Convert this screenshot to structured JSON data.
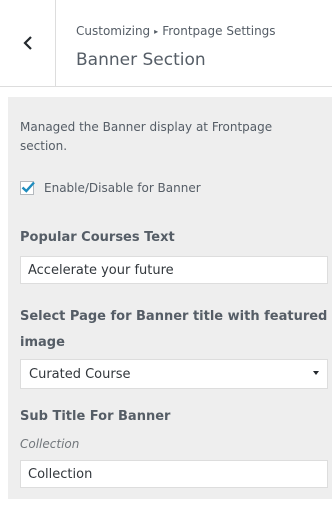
{
  "header": {
    "breadcrumb_root": "Customizing",
    "breadcrumb_separator": "▸",
    "breadcrumb_parent": "Frontpage Settings",
    "section_title": "Banner Section"
  },
  "description": "Managed the Banner display at Frontpage section.",
  "enable_banner": {
    "label": "Enable/Disable for Banner",
    "checked": true
  },
  "popular_courses": {
    "label": "Popular Courses Text",
    "value": "Accelerate your future"
  },
  "banner_page": {
    "label": "Select Page for Banner title with featured image",
    "selected": "Curated Course"
  },
  "sub_title": {
    "label": "Sub Title For Banner",
    "description": "Collection",
    "value": "Collection"
  },
  "colors": {
    "accent": "#0073aa",
    "text": "#555d66",
    "panel_bg": "#eeeeee"
  }
}
